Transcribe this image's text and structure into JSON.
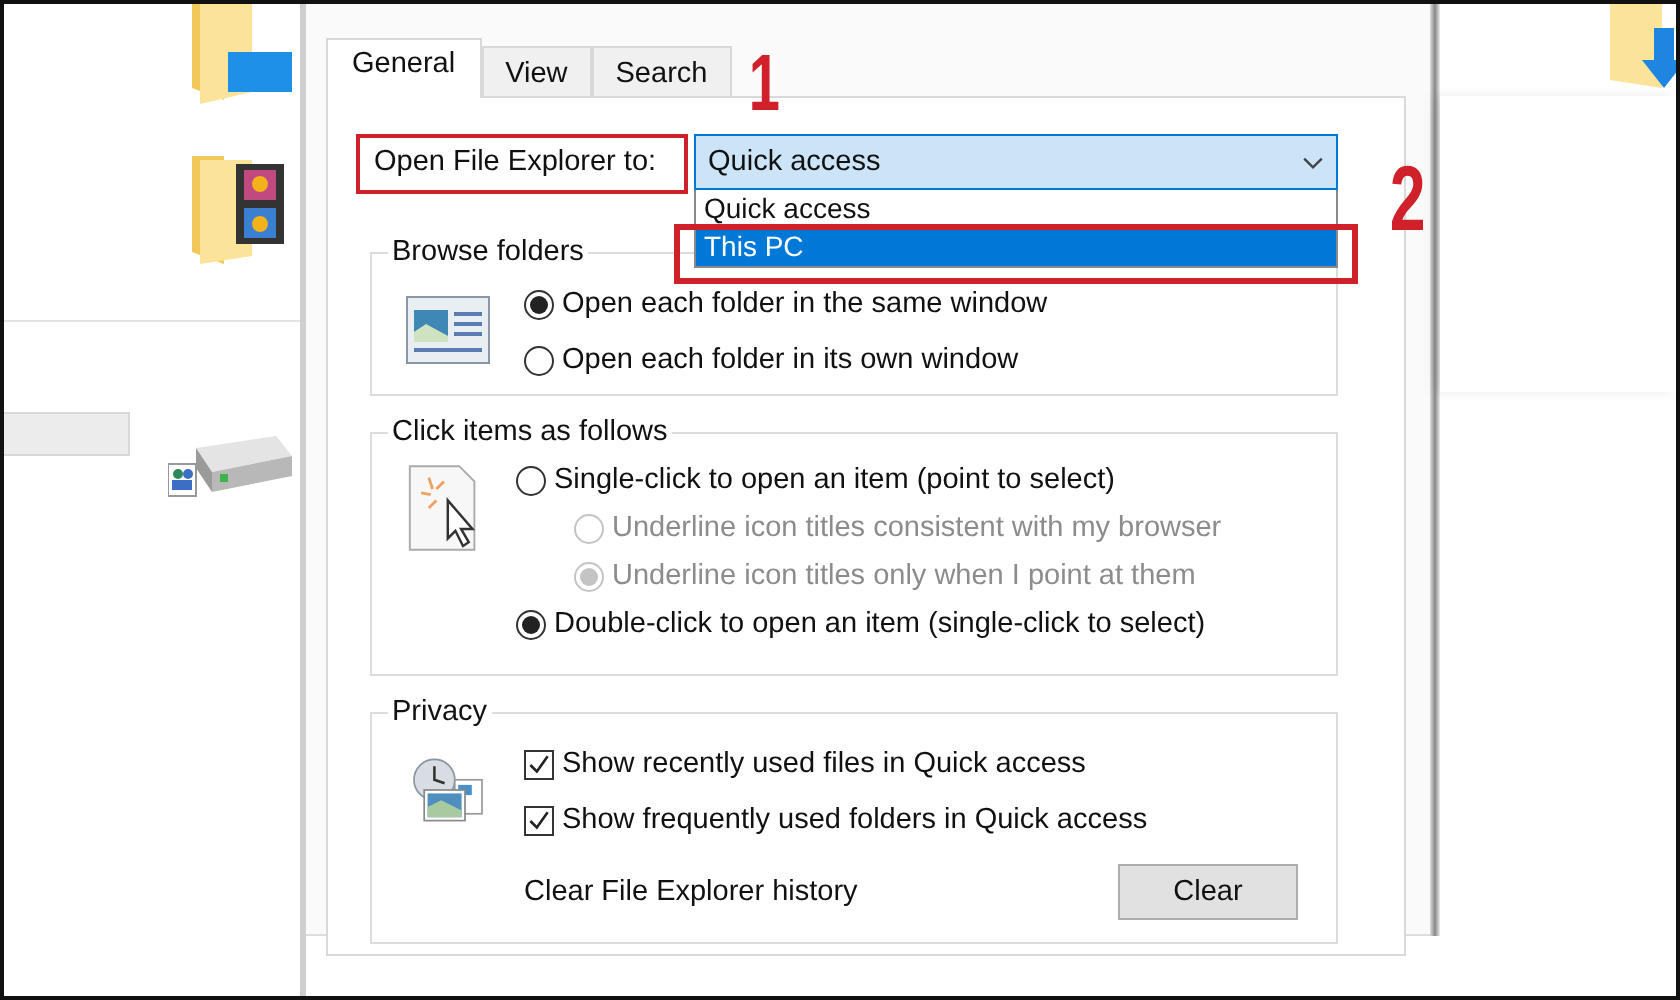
{
  "tabs": [
    {
      "label": "General",
      "selected": true
    },
    {
      "label": "View",
      "selected": false
    },
    {
      "label": "Search",
      "selected": false
    }
  ],
  "open_to": {
    "label": "Open File Explorer to:",
    "value": "Quick access",
    "expanded": true,
    "options": [
      {
        "label": "Quick access",
        "highlighted": false
      },
      {
        "label": "This PC",
        "highlighted": true
      }
    ]
  },
  "browse_folders": {
    "title": "Browse folders",
    "options": [
      {
        "label": "Open each folder in the same window",
        "selected": true
      },
      {
        "label": "Open each folder in its own window",
        "selected": false
      }
    ]
  },
  "click_items": {
    "title": "Click items as follows",
    "options": [
      {
        "label": "Single-click to open an item (point to select)",
        "selected": false,
        "children": [
          {
            "label": "Underline icon titles consistent with my browser",
            "selected": false,
            "disabled": true
          },
          {
            "label": "Underline icon titles only when I point at them",
            "selected": true,
            "disabled": true
          }
        ]
      },
      {
        "label": "Double-click to open an item (single-click to select)",
        "selected": true
      }
    ]
  },
  "privacy": {
    "title": "Privacy",
    "checkboxes": [
      {
        "label": "Show recently used files in Quick access",
        "checked": true
      },
      {
        "label": "Show frequently used folders in Quick access",
        "checked": true
      }
    ],
    "clear_label": "Clear File Explorer history",
    "clear_button": "Clear"
  },
  "annotations": [
    {
      "label": "1"
    },
    {
      "label": "2"
    }
  ]
}
